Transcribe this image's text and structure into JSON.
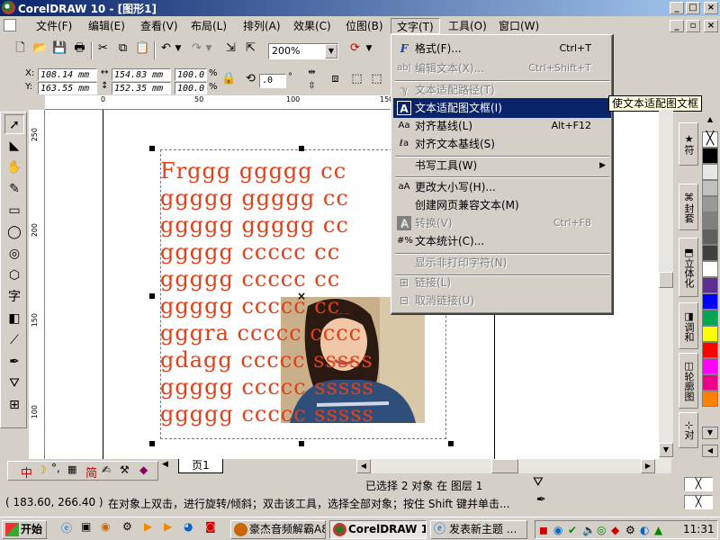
{
  "window": {
    "title": "CorelDRAW 10 - [图形1]"
  },
  "menu": [
    "文件(F)",
    "编辑(E)",
    "查看(V)",
    "布局(L)",
    "排列(A)",
    "效果(C)",
    "位图(B)",
    "文字(T)",
    "工具(O)",
    "窗口(W)"
  ],
  "toolbar": {
    "zoom": "200%"
  },
  "propertybar": {
    "x": "108.14 mm",
    "y": "163.55 mm",
    "w": "154.83 mm",
    "h": "152.35 mm",
    "sx": "100.0",
    "sy": "100.0",
    "pct": "%",
    "angle": ".0",
    "deg": "°"
  },
  "rulers": {
    "h": [
      "0",
      "50",
      "100",
      "150"
    ],
    "v": [
      "250",
      "200",
      "150",
      "100"
    ]
  },
  "canvas_text": [
    "Frggg ggggg cc",
    "ggggg ggggg cc",
    "ggggg ggggg cc",
    "ggggg ccccc cc",
    "ggggg ccccc cc",
    "ggggg ccccc cc",
    "gggra ccccc cccc",
    "gdagg ccccc sssss",
    "ggggg ccccc sssss",
    "ggggg ccccc sssss"
  ],
  "text_menu": {
    "items": [
      {
        "icon": "F",
        "label": "格式(F)...",
        "shortcut": "Ctrl+T",
        "disabled": false
      },
      {
        "icon": "ab|",
        "label": "编辑文本(X)...",
        "shortcut": "Ctrl+Shift+T",
        "disabled": true
      },
      {
        "icon": "ℽ",
        "label": "文本适配路径(T)",
        "shortcut": "",
        "disabled": true
      },
      {
        "icon": "A",
        "label": "文本适配图文框(I)",
        "shortcut": "",
        "disabled": false,
        "highlighted": true
      },
      {
        "icon": "Aa",
        "label": "对齐基线(L)",
        "shortcut": "Alt+F12",
        "disabled": false
      },
      {
        "icon": "ℓa",
        "label": "对齐文本基线(S)",
        "shortcut": "",
        "disabled": false
      },
      {
        "icon": "",
        "label": "书写工具(W)",
        "shortcut": "",
        "disabled": false,
        "submenu": true
      },
      {
        "icon": "aA",
        "label": "更改大小写(H)...",
        "shortcut": "",
        "disabled": false
      },
      {
        "icon": "",
        "label": "创建网页兼容文本(M)",
        "shortcut": "",
        "disabled": false
      },
      {
        "icon": "A",
        "label": "转换(V)",
        "shortcut": "Ctrl+F8",
        "disabled": true
      },
      {
        "icon": "#%",
        "label": "文本统计(C)...",
        "shortcut": "",
        "disabled": false
      },
      {
        "icon": "",
        "label": "显示非打印字符(N)",
        "shortcut": "",
        "disabled": true
      },
      {
        "icon": "⊞",
        "label": "链接(L)",
        "shortcut": "",
        "disabled": true
      },
      {
        "icon": "⊟",
        "label": "取消链接(U)",
        "shortcut": "",
        "disabled": true
      }
    ]
  },
  "tooltip": "使文本适配图文框",
  "dockers": [
    "符",
    "封套",
    "立体化",
    "调和",
    "轮廓图",
    "对"
  ],
  "palette": [
    "#ffffff",
    "#000000",
    "#e6e6e6",
    "#c0c0c0",
    "#999999",
    "#808080",
    "#606060",
    "#404040",
    "#ffffff",
    "#5c2e91",
    "#0000ff",
    "#00a651",
    "#ffff00",
    "#ff0000",
    "#ff00ff",
    "#ec008c",
    "#ff8000"
  ],
  "page_tab": "页1",
  "ime": {
    "mode": "中",
    "layout": "简"
  },
  "status": {
    "selection": "已选择 2 对象 在 图层 1",
    "coords": "( 183.60, 266.40 )",
    "hint": "在对象上双击，进行旋转/倾斜；双击该工具，选择全部对象；按住 Shift 键并单击..."
  },
  "taskbar": {
    "start": "开始",
    "tasks": [
      "豪杰音频解霸A8",
      "CorelDRAW 1...",
      "发表新主题 ..."
    ],
    "clock": "11:31"
  }
}
